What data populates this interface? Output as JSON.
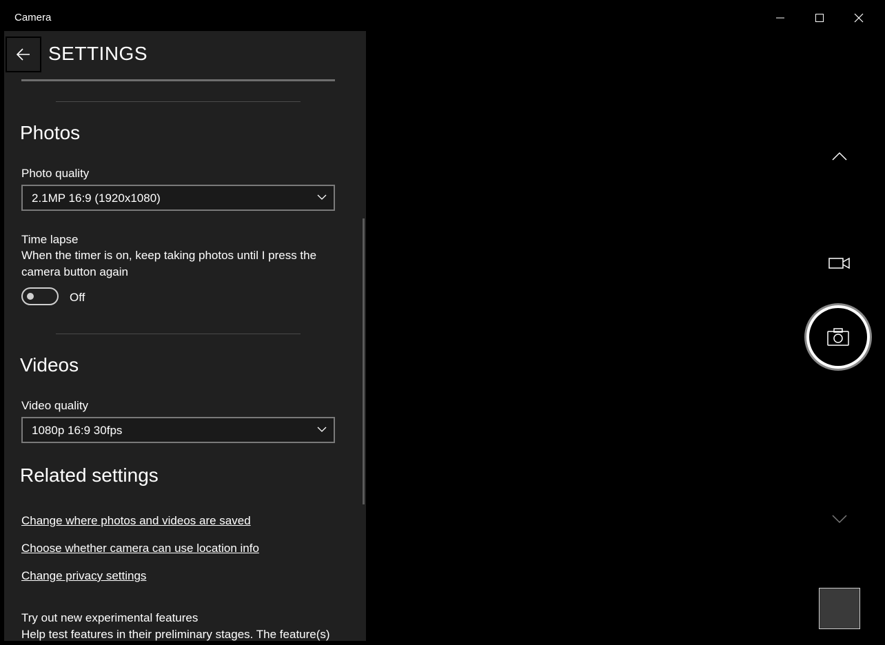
{
  "window": {
    "title": "Camera"
  },
  "settings": {
    "title": "SETTINGS",
    "photos": {
      "title": "Photos",
      "photo_quality_label": "Photo quality",
      "photo_quality_value": "2.1MP 16:9 (1920x1080)",
      "time_lapse_label": "Time lapse",
      "time_lapse_desc": "When the timer is on, keep taking photos until I press the camera button again",
      "time_lapse_state": "Off"
    },
    "videos": {
      "title": "Videos",
      "video_quality_label": "Video quality",
      "video_quality_value": "1080p 16:9 30fps"
    },
    "related": {
      "title": "Related settings",
      "links": [
        "Change where photos and videos are saved",
        "Choose whether camera can use location info",
        "Change privacy settings"
      ]
    },
    "experimental": {
      "label": "Try out new experimental features",
      "desc": "Help test features in their preliminary stages. The feature(s)"
    }
  },
  "icons": {
    "back": "back-arrow-icon",
    "minimize": "minimize-icon",
    "maximize": "maximize-icon",
    "close": "close-icon",
    "chevron_up": "chevron-up-icon",
    "video_mode": "video-camera-icon",
    "photo": "camera-icon",
    "chevron_down": "chevron-down-icon"
  }
}
